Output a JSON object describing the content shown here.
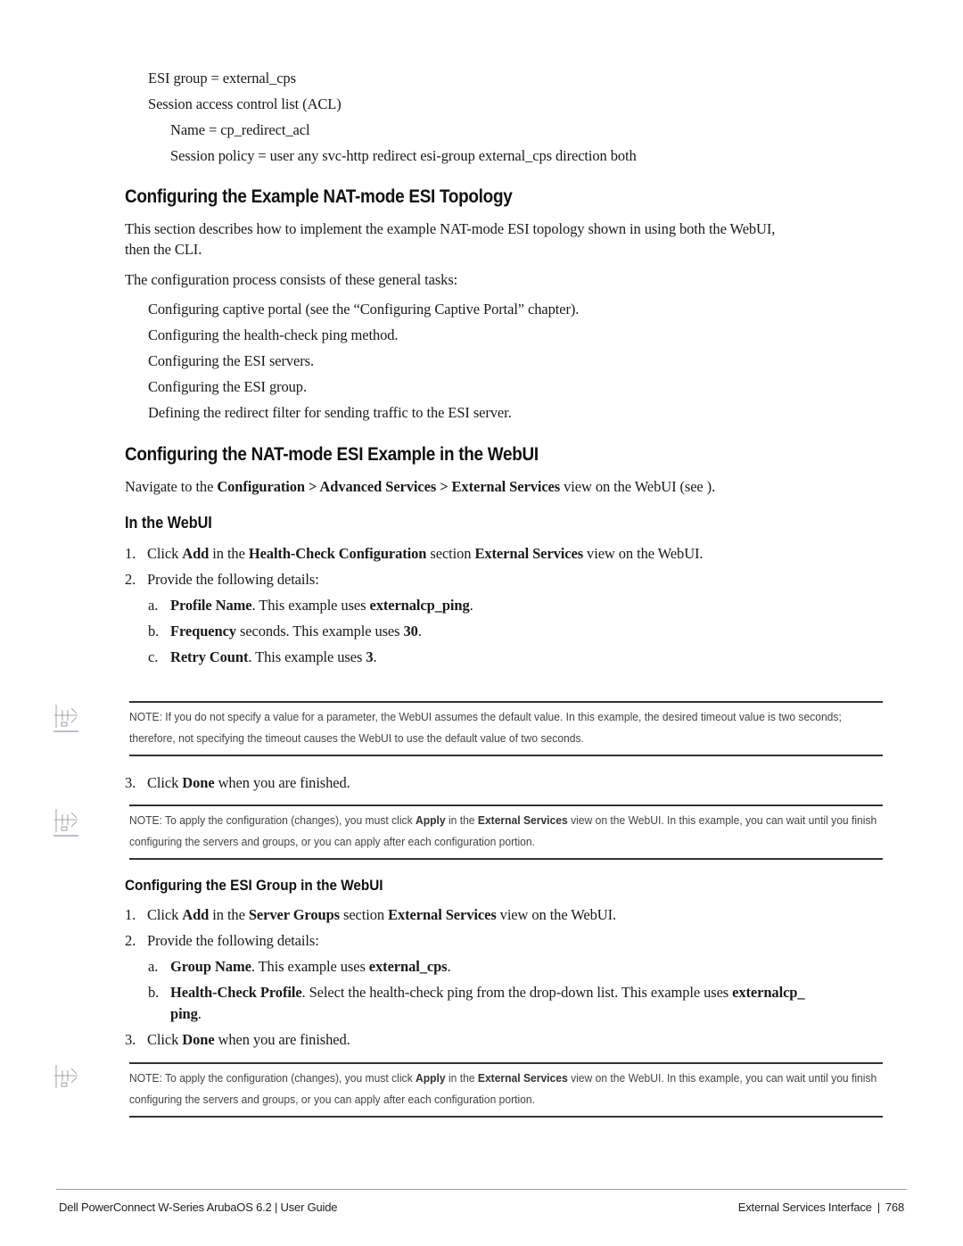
{
  "top_block": {
    "esi_group": "ESI group = external_cps",
    "acl_label": "Session access control list (ACL)",
    "acl_name": "Name = cp_redirect_acl",
    "session_policy": "Session policy = user any svc-http redirect esi-group external_cps direction both"
  },
  "section1": {
    "heading": "Configuring the Example NAT-mode ESI Topology",
    "intro_line1": "This section describes how to implement the example NAT-mode ESI topology shown in using both the WebUI,",
    "intro_line2": "then the CLI.",
    "tasks_intro": "The configuration process consists of these general tasks:",
    "tasks": [
      "Configuring captive portal (see the “Configuring Captive Portal” chapter).",
      "Configuring the health-check ping method.",
      "Configuring the ESI servers.",
      "Configuring the ESI group.",
      "Defining the redirect filter for sending traffic to the ESI server."
    ]
  },
  "section2": {
    "heading": "Configuring the NAT-mode ESI Example in the WebUI",
    "nav": {
      "prefix": "Navigate to the ",
      "path1": "Configuration",
      "sep1": " > ",
      "path2": "Advanced Services",
      "sep2": " > ",
      "path3": "External Services",
      "suffix": " view on the WebUI (see )."
    }
  },
  "webui": {
    "heading": "In the WebUI",
    "step1": {
      "num": "1.",
      "t1": "Click ",
      "b1": "Add",
      "t2": " in the ",
      "b2": "Health-Check Configuration",
      "t3": " section ",
      "b3": "External Services",
      "t4": " view on the WebUI."
    },
    "step2": {
      "num": "2.",
      "text": "Provide the following details:"
    },
    "details": [
      {
        "letter": "a.",
        "bold": "Profile Name",
        "text": ". This example uses ",
        "value": "externalcp_ping",
        "end": "."
      },
      {
        "letter": "b.",
        "bold": "Frequency",
        "text": " seconds. This example uses ",
        "value": "30",
        "end": "."
      },
      {
        "letter": "c.",
        "bold": "Retry Count",
        "text": ". This example uses ",
        "value": "3",
        "end": "."
      }
    ],
    "note1": "NOTE: If you do not specify a value for a parameter, the WebUI assumes the default value. In this example, the desired timeout value is two seconds; therefore, not specifying the timeout causes the WebUI to use the default value of two seconds.",
    "step3": {
      "num": "3.",
      "t1": "Click ",
      "b1": "Done",
      "t2": " when you are finished."
    },
    "note2": {
      "t1": "NOTE: To apply the configuration (changes), you must click ",
      "b1": "Apply",
      "t2": " in the ",
      "b2": "External Services",
      "t3": " view on the WebUI. In this example, you can wait until you finish configuring the servers and groups, or you can apply after each configuration portion."
    }
  },
  "esi_group_section": {
    "heading": "Configuring the ESI Group in the WebUI",
    "step1": {
      "num": "1.",
      "t1": "Click ",
      "b1": "Add",
      "t2": " in the ",
      "b2": "Server Groups",
      "t3": " section ",
      "b3": "External Services",
      "t4": " view on the WebUI."
    },
    "step2": {
      "num": "2.",
      "text": "Provide the following details:"
    },
    "detail_a": {
      "letter": "a.",
      "bold": "Group Name",
      "text": ". This example uses ",
      "value": "external_cps",
      "end": "."
    },
    "detail_b": {
      "letter": "b.",
      "bold": "Health-Check Profile",
      "text": ". Select the health-check ping from the drop-down list. This example uses ",
      "value1": "externalcp_",
      "value2": "ping",
      "end": "."
    },
    "step3": {
      "num": "3.",
      "t1": "Click ",
      "b1": "Done",
      "t2": " when you are finished."
    },
    "note": {
      "t1": "NOTE: To apply the configuration (changes), you must click ",
      "b1": "Apply",
      "t2": " in the ",
      "b2": "External Services",
      "t3": " view on the WebUI. In this example, you can wait until you finish configuring the servers and groups, or you can apply after each configuration portion."
    }
  },
  "footer": {
    "left": "Dell PowerConnect W-Series ArubaOS 6.2 | User Guide",
    "chapter": "External Services Interface",
    "separator": "|",
    "page": "768"
  }
}
